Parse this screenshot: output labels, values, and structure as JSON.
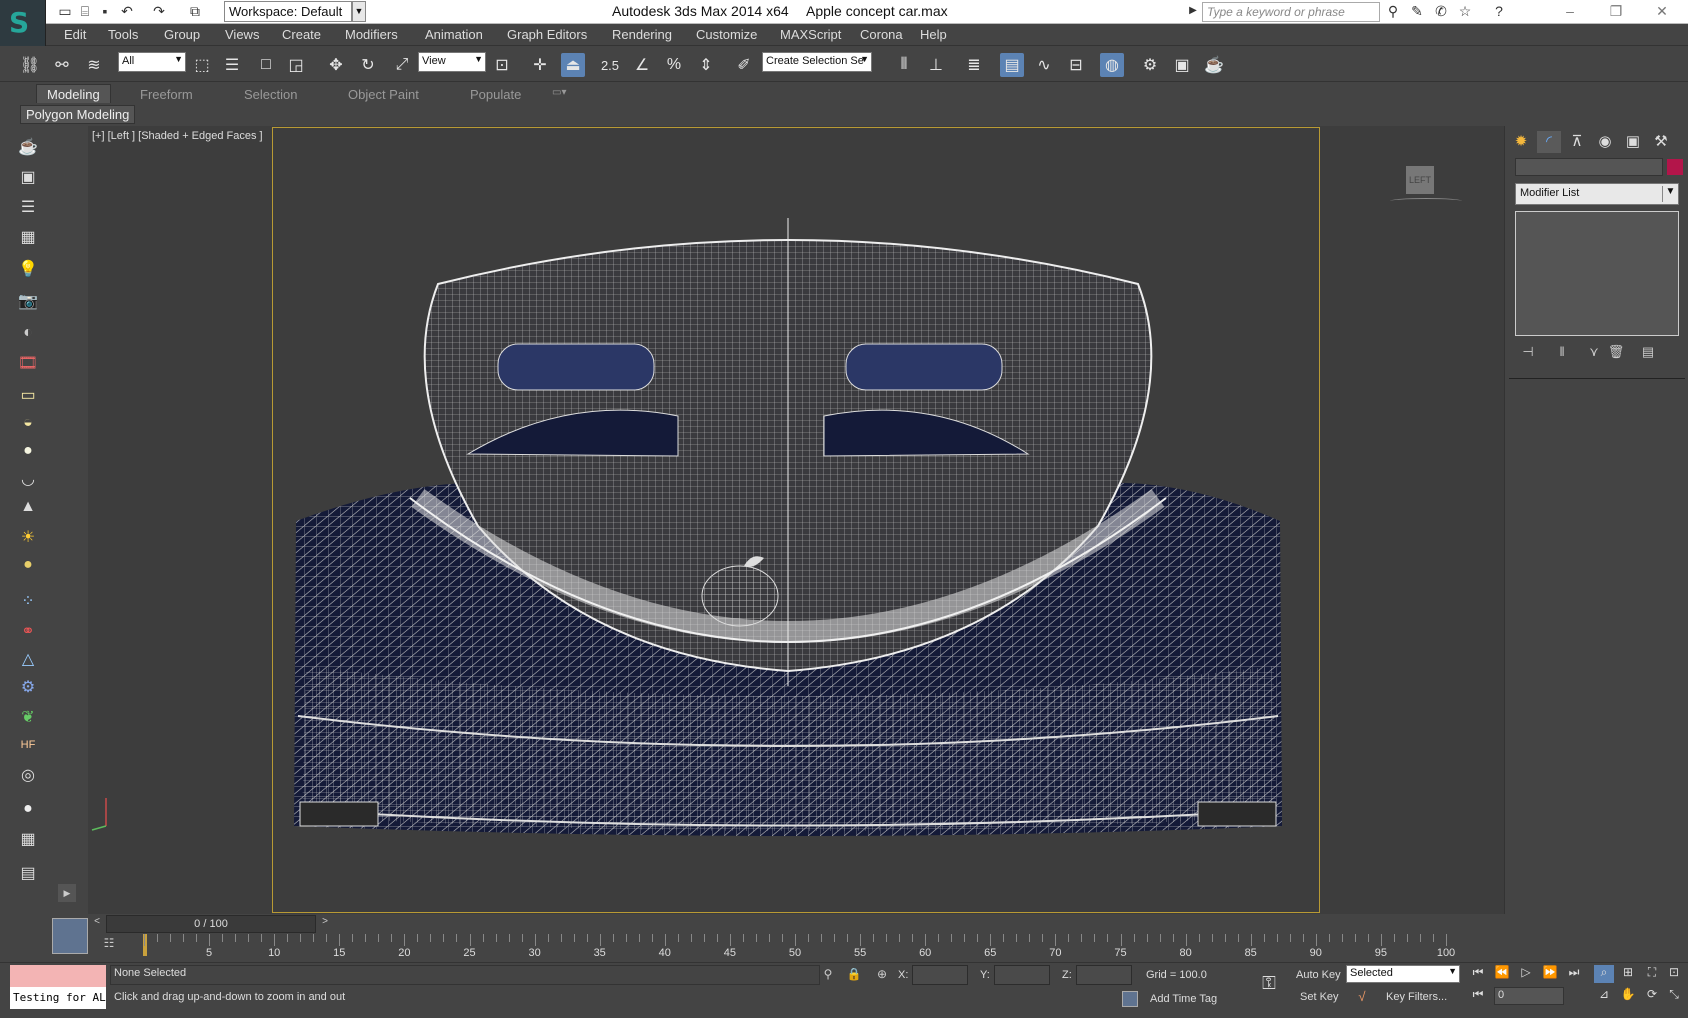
{
  "titlebar": {
    "app_title": "Autodesk 3ds Max  2014 x64",
    "file_name": "Apple concept car.max",
    "workspace": "Workspace: Default",
    "search_placeholder": "Type a keyword or phrase"
  },
  "menu": [
    "Edit",
    "Tools",
    "Group",
    "Views",
    "Create",
    "Modifiers",
    "Animation",
    "Graph Editors",
    "Rendering",
    "Customize",
    "MAXScript",
    "Corona",
    "Help"
  ],
  "toolbar": {
    "selection_filter": "All",
    "ref_coord": "View",
    "named_selection": "Create Selection Se",
    "snap_label": "2.5"
  },
  "ribbon": {
    "tabs": [
      "Modeling",
      "Freeform",
      "Selection",
      "Object Paint",
      "Populate"
    ],
    "active_tab": "Modeling",
    "panel": "Polygon Modeling"
  },
  "viewport": {
    "label": "[+] [Left ] [Shaded + Edged Faces ]",
    "viewcube": "LEFT"
  },
  "command_panel": {
    "modifier_list": "Modifier List",
    "object_color": "#b3154a"
  },
  "time": {
    "slider": "0 / 100",
    "ticks": [
      "5",
      "10",
      "15",
      "20",
      "25",
      "30",
      "35",
      "40",
      "45",
      "50",
      "55",
      "60",
      "65",
      "70",
      "75",
      "80",
      "85",
      "90",
      "95",
      "100"
    ]
  },
  "status": {
    "maxscript_line": "Testing for ALL",
    "selection": "None Selected",
    "prompt": "Click and drag up-and-down to zoom in and out",
    "x_label": "X:",
    "y_label": "Y:",
    "z_label": "Z:",
    "grid": "Grid = 100.0",
    "add_time_tag": "Add Time Tag",
    "auto_key": "Auto Key",
    "set_key": "Set Key",
    "key_mode": "Selected",
    "key_filters": "Key Filters...",
    "frame": "0"
  },
  "colors": {
    "accent": "#5c83b4",
    "safe_frame": "#b89a34",
    "wire": "#d9d9d9",
    "car_fill": "#141a38"
  }
}
